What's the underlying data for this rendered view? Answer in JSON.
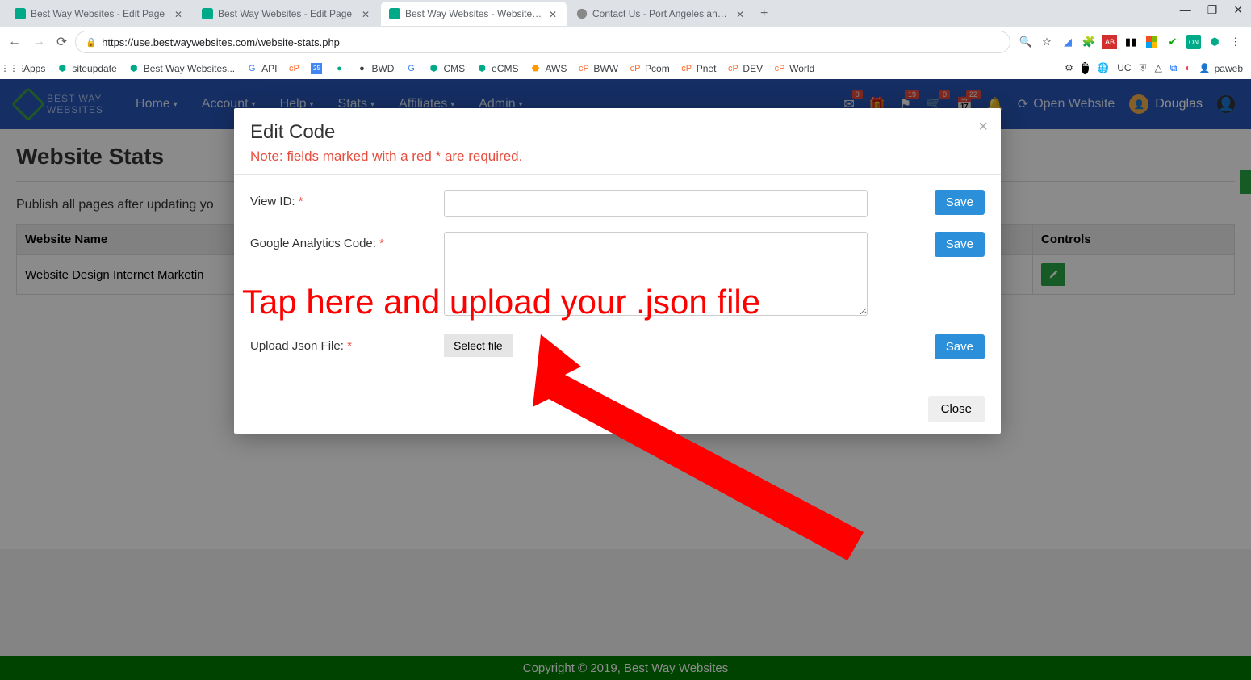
{
  "browser": {
    "tabs": [
      {
        "title": "Best Way Websites - Edit Page"
      },
      {
        "title": "Best Way Websites - Edit Page"
      },
      {
        "title": "Best Way Websites - Website Stat"
      },
      {
        "title": "Contact Us - Port Angeles and Se"
      }
    ],
    "url": "https://use.bestwaywebsites.com/website-stats.php",
    "bookmarks": {
      "apps": "Apps",
      "items": [
        "siteupdate",
        "Best Way Websites...",
        "API",
        "",
        "",
        "BWD",
        "",
        "CMS",
        "eCMS",
        "",
        "AWS",
        "BWW",
        "Pcom",
        "Pnet",
        "DEV",
        "World"
      ],
      "right": "paweb"
    }
  },
  "header": {
    "logo_line1": "BEST WAY",
    "logo_line2": "WEBSITES",
    "nav": [
      "Home",
      "Account",
      "Help",
      "Stats",
      "Affiliates",
      "Admin"
    ],
    "badges": [
      "0",
      "",
      "19",
      "0",
      "22",
      ""
    ],
    "open_site": "Open Website",
    "user": "Douglas"
  },
  "page": {
    "title": "Website Stats",
    "note": "Publish all pages after updating yo",
    "columns": {
      "name": "Website Name",
      "controls": "Controls"
    },
    "row1": "Website Design Internet Marketin"
  },
  "modal": {
    "title": "Edit Code",
    "note": "Note: fields marked with a red * are required.",
    "fields": {
      "view_id": "View ID:",
      "ga_code": "Google Analytics Code:",
      "upload": "Upload Json File:"
    },
    "req": "*",
    "save": "Save",
    "select_file": "Select file",
    "close": "Close"
  },
  "annotation": "Tap here and upload your .json file",
  "footer": "Copyright © 2019, Best Way Websites"
}
